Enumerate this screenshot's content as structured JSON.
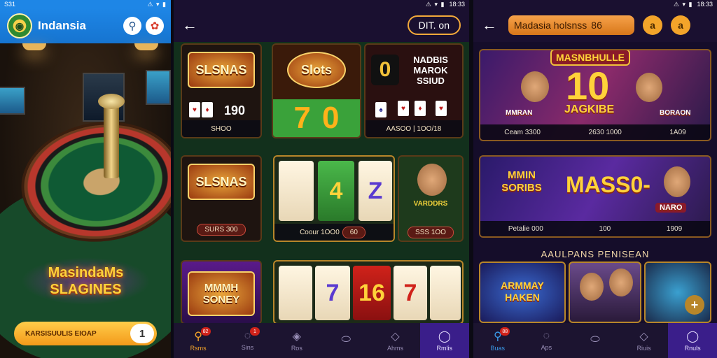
{
  "screen1": {
    "status_left": "S31",
    "status_icons": "⚠ ▾ ▮",
    "app_title": "Indansia",
    "promo": "MasindaMs SLAGINES",
    "cta_label": "KARSISUULIS EIOAP",
    "cta_number": "1"
  },
  "screen2": {
    "status_time": "18:33",
    "status_icons": "⚠ ▾ ▮",
    "header_button": "DIT. on",
    "tiles": [
      {
        "badge": "SLSNAS",
        "foot": "SHOO"
      },
      {
        "badge": "Slots",
        "foot": ""
      },
      {
        "badge": "NADBIS MAROK SSIUD",
        "foot": "AASOO | 1OO/18"
      },
      {
        "badge": "SLSNAS",
        "foot": "SURS 300"
      },
      {
        "badge": "",
        "foot": "Coour 1OO0"
      },
      {
        "badge": "VARDDRS",
        "foot": "SSS 1OO"
      },
      {
        "badge": "MMMH SONEY",
        "foot": ""
      }
    ],
    "card_value": "190",
    "reel_digits": [
      "7",
      "0",
      "0"
    ],
    "reel2": [
      "",
      "4",
      "Z"
    ],
    "reel3": [
      "",
      "7",
      "16",
      "7",
      ""
    ],
    "badge_pill": "60",
    "nav": [
      {
        "label": "Rsms",
        "badge": "82"
      },
      {
        "label": "Sins",
        "badge": "1"
      },
      {
        "label": "Ros",
        "badge": ""
      },
      {
        "label": "",
        "badge": ""
      },
      {
        "label": "Ahms",
        "badge": ""
      },
      {
        "label": "Rmlis",
        "badge": ""
      }
    ]
  },
  "screen3": {
    "status_time": "18:33",
    "status_icons": "⚠ ▾ ▮",
    "search_text": "Madasia holsnss",
    "search_suffix": "86",
    "btn1": "a",
    "btn2": "a",
    "banner1": {
      "title": "MASNBHULLE",
      "big": "10",
      "sub": "JAGKIBE",
      "left_badge": "MMRAN",
      "right_badge": "BORAON",
      "foot": [
        "Ceam 3300",
        "2630 1000",
        "1A09"
      ]
    },
    "banner2": {
      "big": "MASS0-",
      "left": "MMIN SORIBS",
      "right_badge": "NARO",
      "foot": [
        "Petalie 000",
        "100",
        "1909"
      ]
    },
    "section_title": "AAULPANS PENISEAN",
    "mini1": "ARMMAY HAKEN",
    "mini4": "+",
    "nav": [
      {
        "label": "Buas",
        "badge": "88"
      },
      {
        "label": "Aps",
        "badge": ""
      },
      {
        "label": "",
        "badge": ""
      },
      {
        "label": "Riuis",
        "badge": ""
      },
      {
        "label": "Rnuls",
        "badge": ""
      }
    ]
  }
}
